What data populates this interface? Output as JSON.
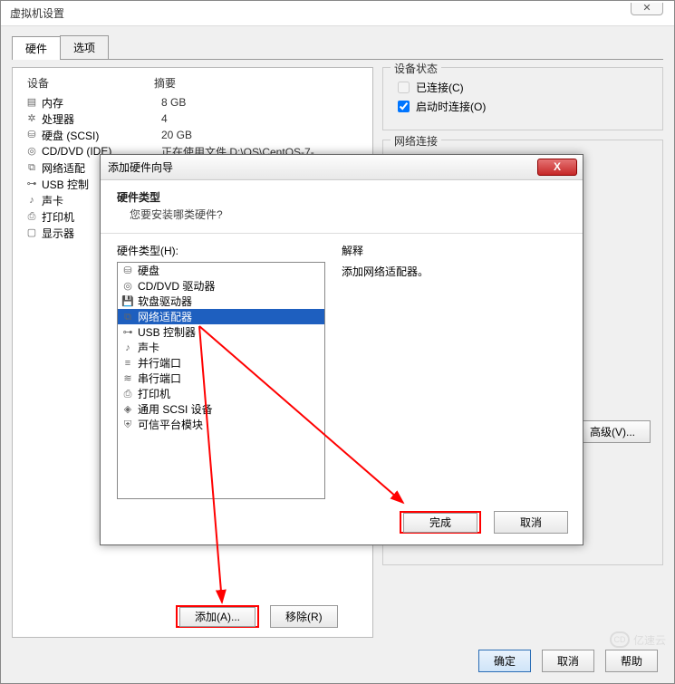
{
  "window": {
    "title": "虚拟机设置",
    "close_glyph": "✕"
  },
  "tabs": {
    "hardware": "硬件",
    "options": "选项"
  },
  "device_table": {
    "header_device": "设备",
    "header_summary": "摘要",
    "rows": [
      {
        "icon": "memory-icon",
        "name": "内存",
        "summary": "8 GB"
      },
      {
        "icon": "cpu-icon",
        "name": "处理器",
        "summary": "4"
      },
      {
        "icon": "disk-icon",
        "name": "硬盘 (SCSI)",
        "summary": "20 GB"
      },
      {
        "icon": "cd-icon",
        "name": "CD/DVD (IDE)",
        "summary": "正在使用文件 D:\\OS\\CentOS-7-..."
      },
      {
        "icon": "nic-icon",
        "name": "网络适配",
        "summary": ""
      },
      {
        "icon": "usb-icon",
        "name": "USB 控制",
        "summary": ""
      },
      {
        "icon": "sound-icon",
        "name": "声卡",
        "summary": ""
      },
      {
        "icon": "printer-icon",
        "name": "打印机",
        "summary": ""
      },
      {
        "icon": "display-icon",
        "name": "显示器",
        "summary": ""
      }
    ]
  },
  "buttons": {
    "add": "添加(A)...",
    "remove": "移除(R)",
    "ok": "确定",
    "cancel": "取消",
    "help": "帮助",
    "advanced": "高级(V)..."
  },
  "status": {
    "legend": "设备状态",
    "connected": "已连接(C)",
    "connect_on_poweron": "启动时连接(O)"
  },
  "network": {
    "legend": "网络连接"
  },
  "wizard": {
    "title": "添加硬件向导",
    "close_glyph": "X",
    "heading": "硬件类型",
    "subheading": "您要安装哪类硬件?",
    "list_label": "硬件类型(H):",
    "explain_label": "解释",
    "explain_text": "添加网络适配器。",
    "items": [
      {
        "icon": "disk-icon",
        "label": "硬盘"
      },
      {
        "icon": "cd-icon",
        "label": "CD/DVD 驱动器"
      },
      {
        "icon": "floppy-icon",
        "label": "软盘驱动器"
      },
      {
        "icon": "nic-icon",
        "label": "网络适配器",
        "selected": true
      },
      {
        "icon": "usb-icon",
        "label": "USB 控制器"
      },
      {
        "icon": "sound-icon",
        "label": "声卡"
      },
      {
        "icon": "parallel-icon",
        "label": "并行端口"
      },
      {
        "icon": "serial-icon",
        "label": "串行端口"
      },
      {
        "icon": "printer-icon",
        "label": "打印机"
      },
      {
        "icon": "scsi-icon",
        "label": "通用 SCSI 设备"
      },
      {
        "icon": "tpm-icon",
        "label": "可信平台模块"
      }
    ],
    "finish": "完成",
    "cancel": "取消"
  },
  "watermark": "亿速云"
}
